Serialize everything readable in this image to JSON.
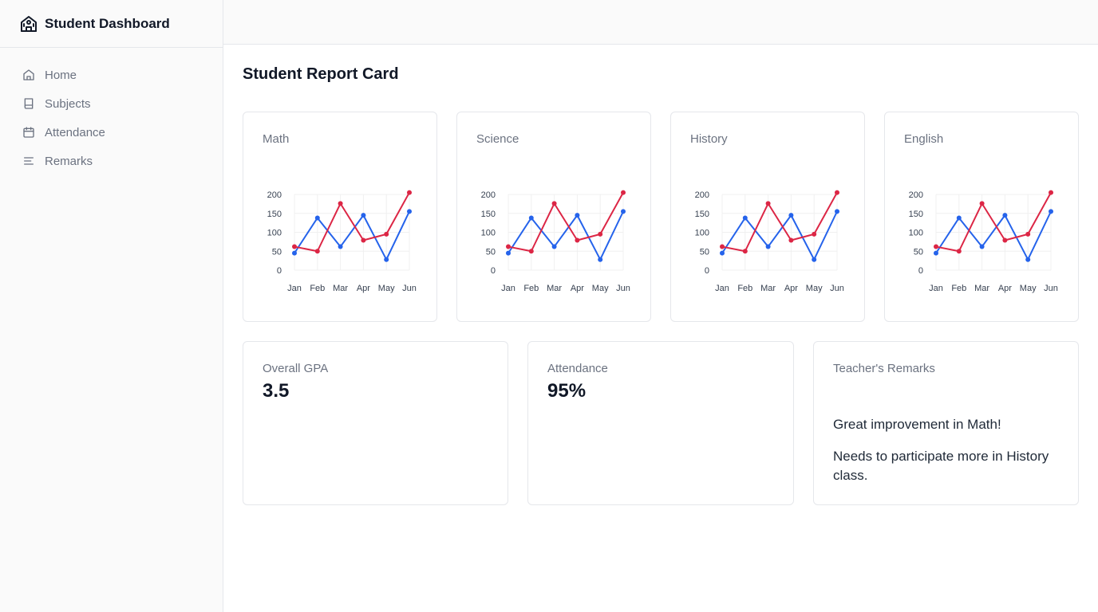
{
  "app": {
    "title": "Student Dashboard"
  },
  "sidebar": {
    "items": [
      {
        "label": "Home",
        "icon": "home-icon"
      },
      {
        "label": "Subjects",
        "icon": "book-icon"
      },
      {
        "label": "Attendance",
        "icon": "calendar-icon"
      },
      {
        "label": "Remarks",
        "icon": "lines-icon"
      }
    ]
  },
  "page": {
    "title": "Student Report Card"
  },
  "colors": {
    "series_blue": "#2563eb",
    "series_red": "#dc2645"
  },
  "chart_data": [
    {
      "type": "line",
      "title": "Math",
      "categories": [
        "Jan",
        "Feb",
        "Mar",
        "Apr",
        "May",
        "Jun"
      ],
      "ylim": [
        0,
        200
      ],
      "yticks": [
        "0",
        "50",
        "100",
        "150",
        "200"
      ],
      "grid": true,
      "series": [
        {
          "color": "#2563eb",
          "values": [
            45,
            138,
            62,
            145,
            28,
            155
          ]
        },
        {
          "color": "#dc2645",
          "values": [
            62,
            50,
            176,
            79,
            95,
            205
          ]
        }
      ]
    },
    {
      "type": "line",
      "title": "Science",
      "categories": [
        "Jan",
        "Feb",
        "Mar",
        "Apr",
        "May",
        "Jun"
      ],
      "ylim": [
        0,
        200
      ],
      "yticks": [
        "0",
        "50",
        "100",
        "150",
        "200"
      ],
      "grid": true,
      "series": [
        {
          "color": "#2563eb",
          "values": [
            45,
            138,
            62,
            145,
            28,
            155
          ]
        },
        {
          "color": "#dc2645",
          "values": [
            62,
            50,
            176,
            79,
            95,
            205
          ]
        }
      ]
    },
    {
      "type": "line",
      "title": "History",
      "categories": [
        "Jan",
        "Feb",
        "Mar",
        "Apr",
        "May",
        "Jun"
      ],
      "ylim": [
        0,
        200
      ],
      "yticks": [
        "0",
        "50",
        "100",
        "150",
        "200"
      ],
      "grid": true,
      "series": [
        {
          "color": "#2563eb",
          "values": [
            45,
            138,
            62,
            145,
            28,
            155
          ]
        },
        {
          "color": "#dc2645",
          "values": [
            62,
            50,
            176,
            79,
            95,
            205
          ]
        }
      ]
    },
    {
      "type": "line",
      "title": "English",
      "categories": [
        "Jan",
        "Feb",
        "Mar",
        "Apr",
        "May",
        "Jun"
      ],
      "ylim": [
        0,
        200
      ],
      "yticks": [
        "0",
        "50",
        "100",
        "150",
        "200"
      ],
      "grid": true,
      "series": [
        {
          "color": "#2563eb",
          "values": [
            45,
            138,
            62,
            145,
            28,
            155
          ]
        },
        {
          "color": "#dc2645",
          "values": [
            62,
            50,
            176,
            79,
            95,
            205
          ]
        }
      ]
    }
  ],
  "stats": {
    "gpa": {
      "label": "Overall GPA",
      "value": "3.5"
    },
    "attendance": {
      "label": "Attendance",
      "value": "95%"
    },
    "remarks": {
      "label": "Teacher's Remarks",
      "items": [
        "Great improvement in Math!",
        "Needs to participate more in History class."
      ]
    }
  }
}
